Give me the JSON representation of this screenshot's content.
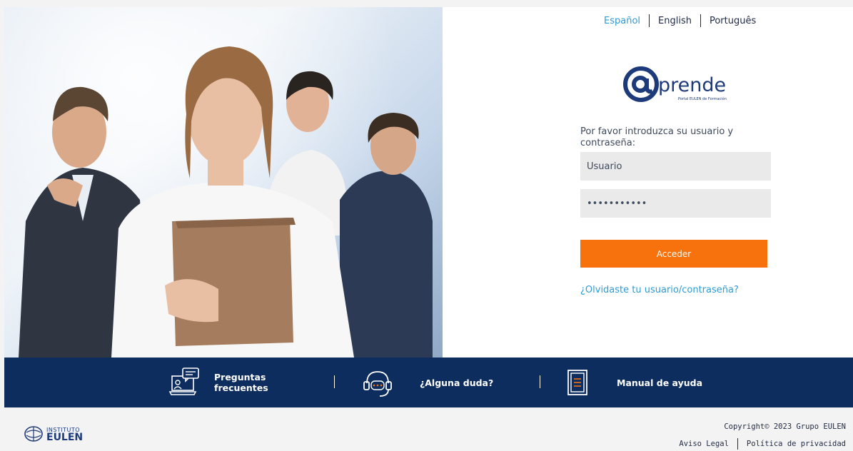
{
  "languages": {
    "items": [
      "Español",
      "English",
      "Português"
    ],
    "active": "Español"
  },
  "logo": {
    "brand": "prende",
    "tagline": "Portal EULEN de Formación"
  },
  "login": {
    "prompt": "Por favor introduzca su usuario y contraseña:",
    "username_value": "Usuario",
    "password_value": "•••••••••••",
    "submit_label": "Acceder",
    "forgot_link": "¿Olvidaste tu usuario/contraseña?"
  },
  "help_bar": {
    "faq_label_line1": "Preguntas",
    "faq_label_line2": "frecuentes",
    "question_label": "¿Alguna duda?",
    "manual_label": "Manual de ayuda"
  },
  "footer": {
    "institute_line1": "INSTITUTO",
    "institute_line2": "EULEN",
    "copyright": "Copyright© 2023 Grupo EULEN",
    "legal_link": "Aviso Legal",
    "privacy_link": "Política de privacidad"
  },
  "colors": {
    "accent_orange": "#f7720c",
    "navy": "#0c2d5e",
    "link_blue": "#2e9bd6"
  }
}
